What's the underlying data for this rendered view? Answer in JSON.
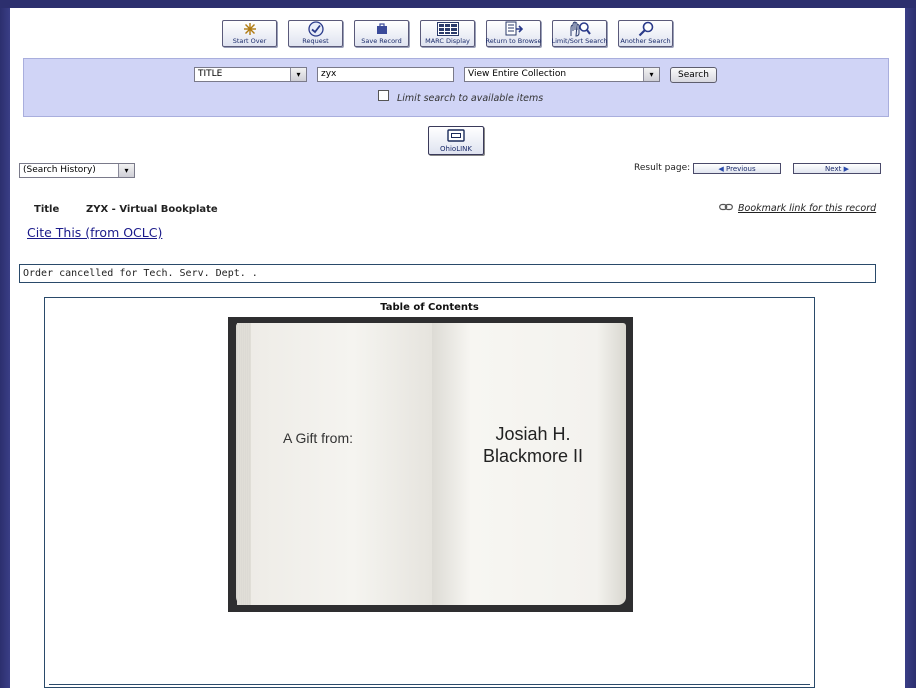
{
  "toolbar": {
    "buttons": [
      {
        "label": "Start Over",
        "icon": "start-over-icon"
      },
      {
        "label": "Request",
        "icon": "request-check-icon"
      },
      {
        "label": "Save Record",
        "icon": "save-record-icon"
      },
      {
        "label": "MARC Display",
        "icon": "marc-display-icon"
      },
      {
        "label": "Return to Browse",
        "icon": "return-browse-icon"
      },
      {
        "label": "Limit/Sort Search",
        "icon": "limit-sort-icon"
      },
      {
        "label": "Another Search",
        "icon": "another-search-icon"
      }
    ]
  },
  "search": {
    "field_type": "TITLE",
    "query": "zyx",
    "scope": "View Entire Collection",
    "button_label": "Search",
    "limit_label": "Limit search to available items",
    "limit_checked": false
  },
  "ohiolink": {
    "label": "OhioLINK"
  },
  "history": {
    "selected": "(Search History)"
  },
  "result_nav": {
    "label": "Result page:",
    "previous": "Previous",
    "next": "Next"
  },
  "record": {
    "title_label": "Title",
    "title_value": "ZYX - Virtual Bookplate",
    "bookmark_label": "Bookmark link for this record",
    "cite_label": "Cite This (from OCLC)",
    "order_status": "Order cancelled for Tech. Serv. Dept. ."
  },
  "toc": {
    "heading": "Table of Contents",
    "bookplate_left": "A Gift from:",
    "bookplate_name_line1": "Josiah H.",
    "bookplate_name_line2": "Blackmore II"
  },
  "colors": {
    "frame": "#2c2f6e",
    "search_panel": "#d0d4f6",
    "border": "#2a4a6a"
  }
}
